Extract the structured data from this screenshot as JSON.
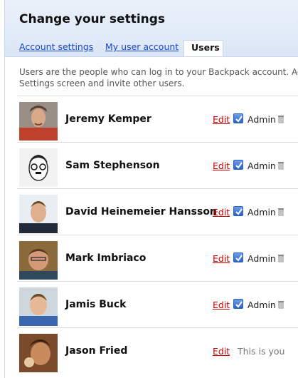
{
  "page": {
    "title": "Change your settings"
  },
  "tabs": [
    {
      "label": "Account settings",
      "active": false
    },
    {
      "label": "My user account",
      "active": false
    },
    {
      "label": "Users",
      "active": true
    }
  ],
  "intro": {
    "line1": "Users are the people who can log in to your Backpack account. Ad",
    "line2": "Settings screen and invite other users."
  },
  "users": [
    {
      "name": "Jeremy Kemper",
      "edit_label": "Edit",
      "admin_label": "Admin",
      "admin_checked": true,
      "avatar_icon": "avatar-photo"
    },
    {
      "name": "Sam Stephenson",
      "edit_label": "Edit",
      "admin_label": "Admin",
      "admin_checked": true,
      "avatar_icon": "avatar-sketch"
    },
    {
      "name": "David Heinemeier Hansson",
      "edit_label": "Edit",
      "admin_label": "Admin",
      "admin_checked": true,
      "avatar_icon": "avatar-photo"
    },
    {
      "name": "Mark Imbriaco",
      "edit_label": "Edit",
      "admin_label": "Admin",
      "admin_checked": true,
      "avatar_icon": "avatar-photo"
    },
    {
      "name": "Jamis Buck",
      "edit_label": "Edit",
      "admin_label": "Admin",
      "admin_checked": true,
      "avatar_icon": "avatar-photo"
    },
    {
      "name": "Jason Fried",
      "edit_label": "Edit",
      "self_label": "This is you",
      "avatar_icon": "avatar-photo"
    }
  ],
  "colors": {
    "header_bg": "#dbe6f6",
    "link": "#1a46c8",
    "edit_link": "#cc0000",
    "checkbox": "#2b62c9"
  }
}
